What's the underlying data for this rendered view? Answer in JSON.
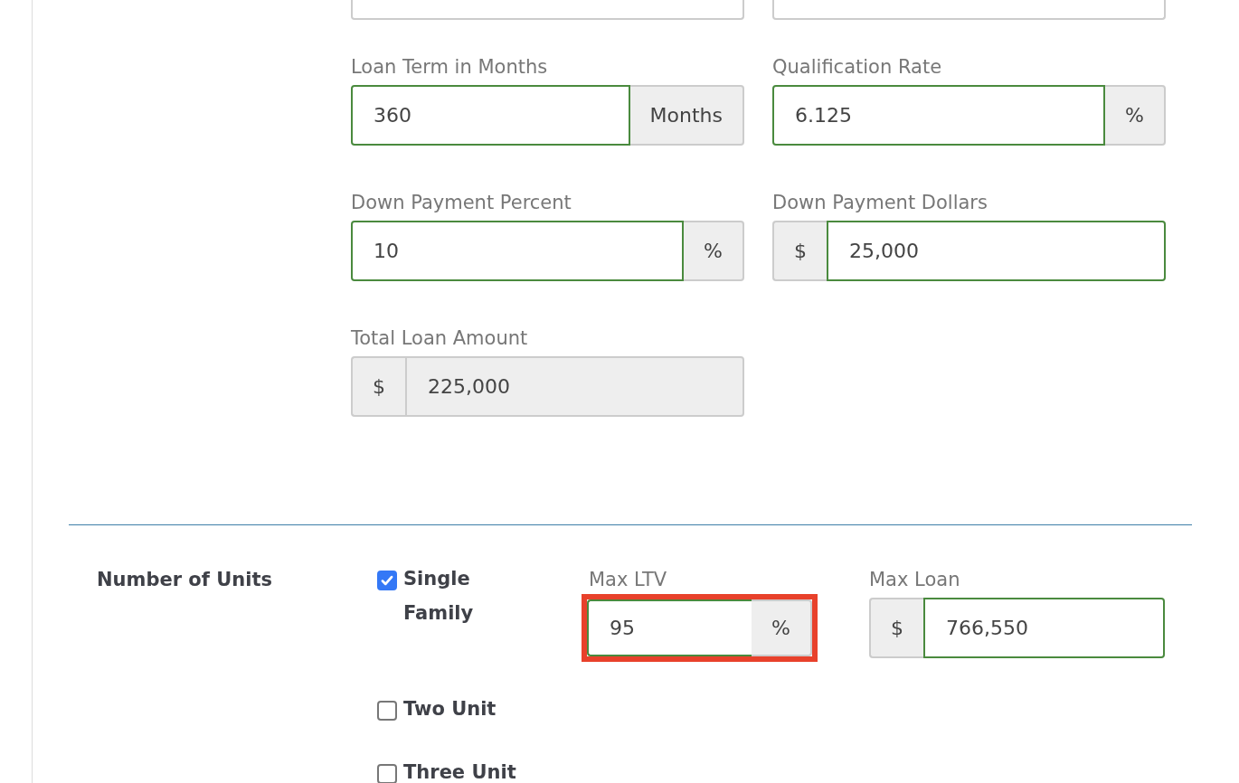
{
  "loan_fields": [
    {
      "label": "Loan Term in Months",
      "value": "360",
      "suffix": "Months",
      "disabled": false,
      "valid": true
    },
    {
      "label": "Qualification Rate",
      "value": "6.125",
      "suffix": "%",
      "disabled": false,
      "valid": true
    },
    {
      "label": "Down Payment Percent",
      "value": "10",
      "suffix": "%",
      "disabled": false,
      "valid": true
    },
    {
      "label": "Down Payment Dollars",
      "value": "25,000",
      "prefix": "$",
      "disabled": false,
      "valid": true
    },
    {
      "label": "Total Loan Amount",
      "value": "225,000",
      "prefix": "$",
      "disabled": true,
      "valid": false
    }
  ],
  "units": {
    "label": "Number of Units",
    "options": [
      {
        "label": "Single Family",
        "checked": true
      },
      {
        "label": "Two Unit",
        "checked": false
      },
      {
        "label": "Three Unit",
        "checked": false
      }
    ],
    "max_ltv": {
      "label": "Max LTV",
      "value": "95",
      "suffix": "%",
      "highlighted": true
    },
    "max_loan": {
      "label": "Max Loan",
      "value": "766,550",
      "prefix": "$",
      "valid": true
    }
  }
}
